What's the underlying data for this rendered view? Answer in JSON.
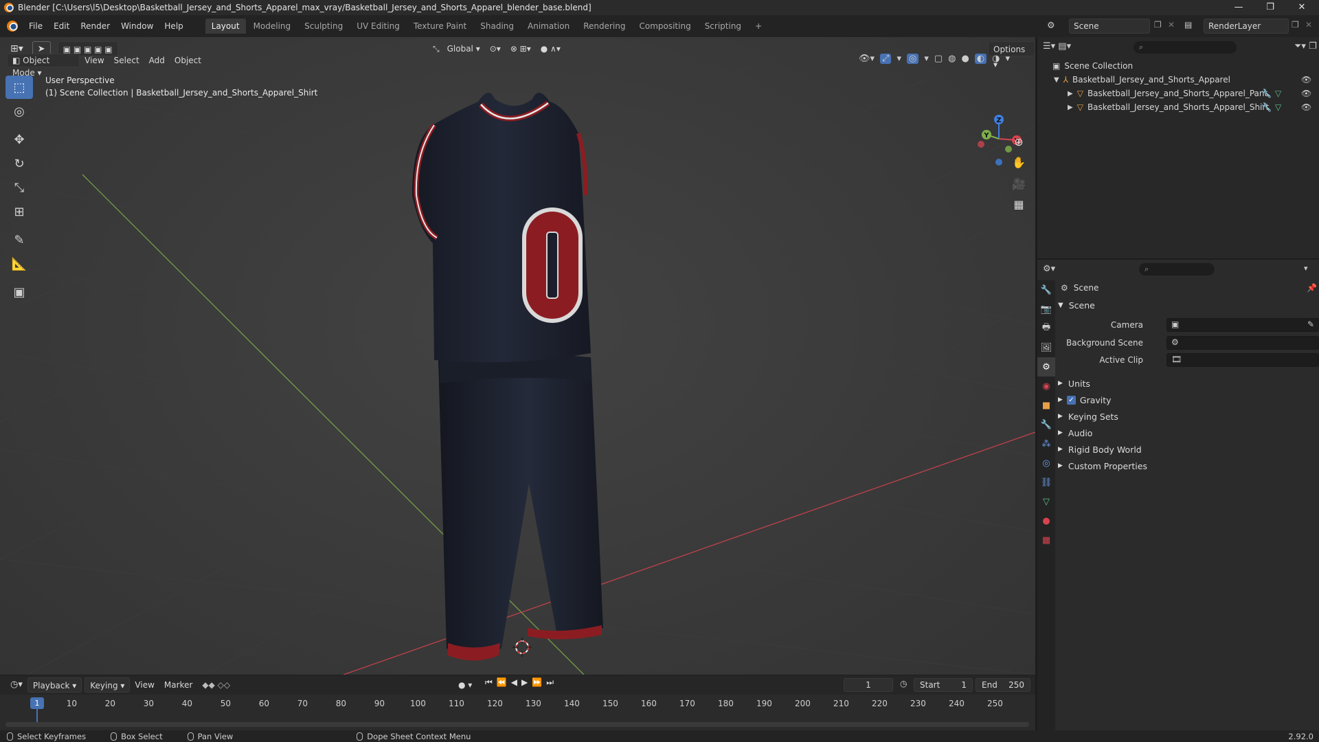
{
  "title_bar": {
    "title": "Blender [C:\\Users\\l5\\Desktop\\Basketball_Jersey_and_Shorts_Apparel_max_vray/Basketball_Jersey_and_Shorts_Apparel_blender_base.blend]",
    "minimize": "—",
    "maximize": "❐",
    "close": "✕"
  },
  "menu": {
    "file": "File",
    "edit": "Edit",
    "render": "Render",
    "window": "Window",
    "help": "Help"
  },
  "workspaces": [
    "Layout",
    "Modeling",
    "Sculpting",
    "UV Editing",
    "Texture Paint",
    "Shading",
    "Animation",
    "Rendering",
    "Compositing",
    "Scripting"
  ],
  "workspace_add": "+",
  "scene_selector": {
    "value": "Scene"
  },
  "render_layer": {
    "value": "RenderLayer"
  },
  "viewport_header": {
    "mode": "Object Mode",
    "view": "View",
    "select": "Select",
    "add": "Add",
    "object": "Object",
    "transform_orientation": "Global",
    "options": "Options"
  },
  "viewport": {
    "perspective": "User Perspective",
    "collection_path": "(1) Scene Collection | Basketball_Jersey_and_Shorts_Apparel_Shirt",
    "jersey_number": "0",
    "gizmo": {
      "x": "X",
      "y": "Y",
      "z": "Z"
    }
  },
  "outliner": {
    "root": "Scene Collection",
    "items": [
      {
        "name": "Basketball_Jersey_and_Shorts_Apparel"
      },
      {
        "name": "Basketball_Jersey_and_Shorts_Apparel_Pant"
      },
      {
        "name": "Basketball_Jersey_and_Shorts_Apparel_Shirt"
      }
    ]
  },
  "properties": {
    "context": "Scene",
    "panel_title": "Scene",
    "camera_label": "Camera",
    "background_scene_label": "Background Scene",
    "active_clip_label": "Active Clip",
    "panels": [
      "Units",
      "Gravity",
      "Keying Sets",
      "Audio",
      "Rigid Body World",
      "Custom Properties"
    ],
    "gravity_enabled": true
  },
  "timeline": {
    "playback": "Playback",
    "keying": "Keying",
    "view": "View",
    "marker": "Marker",
    "current_frame": "1",
    "start_label": "Start",
    "start_value": "1",
    "end_label": "End",
    "end_value": "250",
    "ticks": [
      "10",
      "20",
      "30",
      "40",
      "50",
      "60",
      "70",
      "80",
      "90",
      "100",
      "110",
      "120",
      "130",
      "140",
      "150",
      "160",
      "170",
      "180",
      "190",
      "200",
      "210",
      "220",
      "230",
      "240",
      "250"
    ],
    "playhead": "1"
  },
  "status_bar": {
    "select_keyframes": "Select Keyframes",
    "box_select": "Box Select",
    "pan_view": "Pan View",
    "context_menu": "Dope Sheet Context Menu",
    "version": "2.92.0"
  },
  "colors": {
    "accent": "#4772b3",
    "jersey": "#1b1f2b",
    "jersey_trim": "#8b1d22",
    "x_axis": "#d8434e",
    "y_axis": "#7fb04a",
    "z_axis": "#3f7fe0"
  }
}
